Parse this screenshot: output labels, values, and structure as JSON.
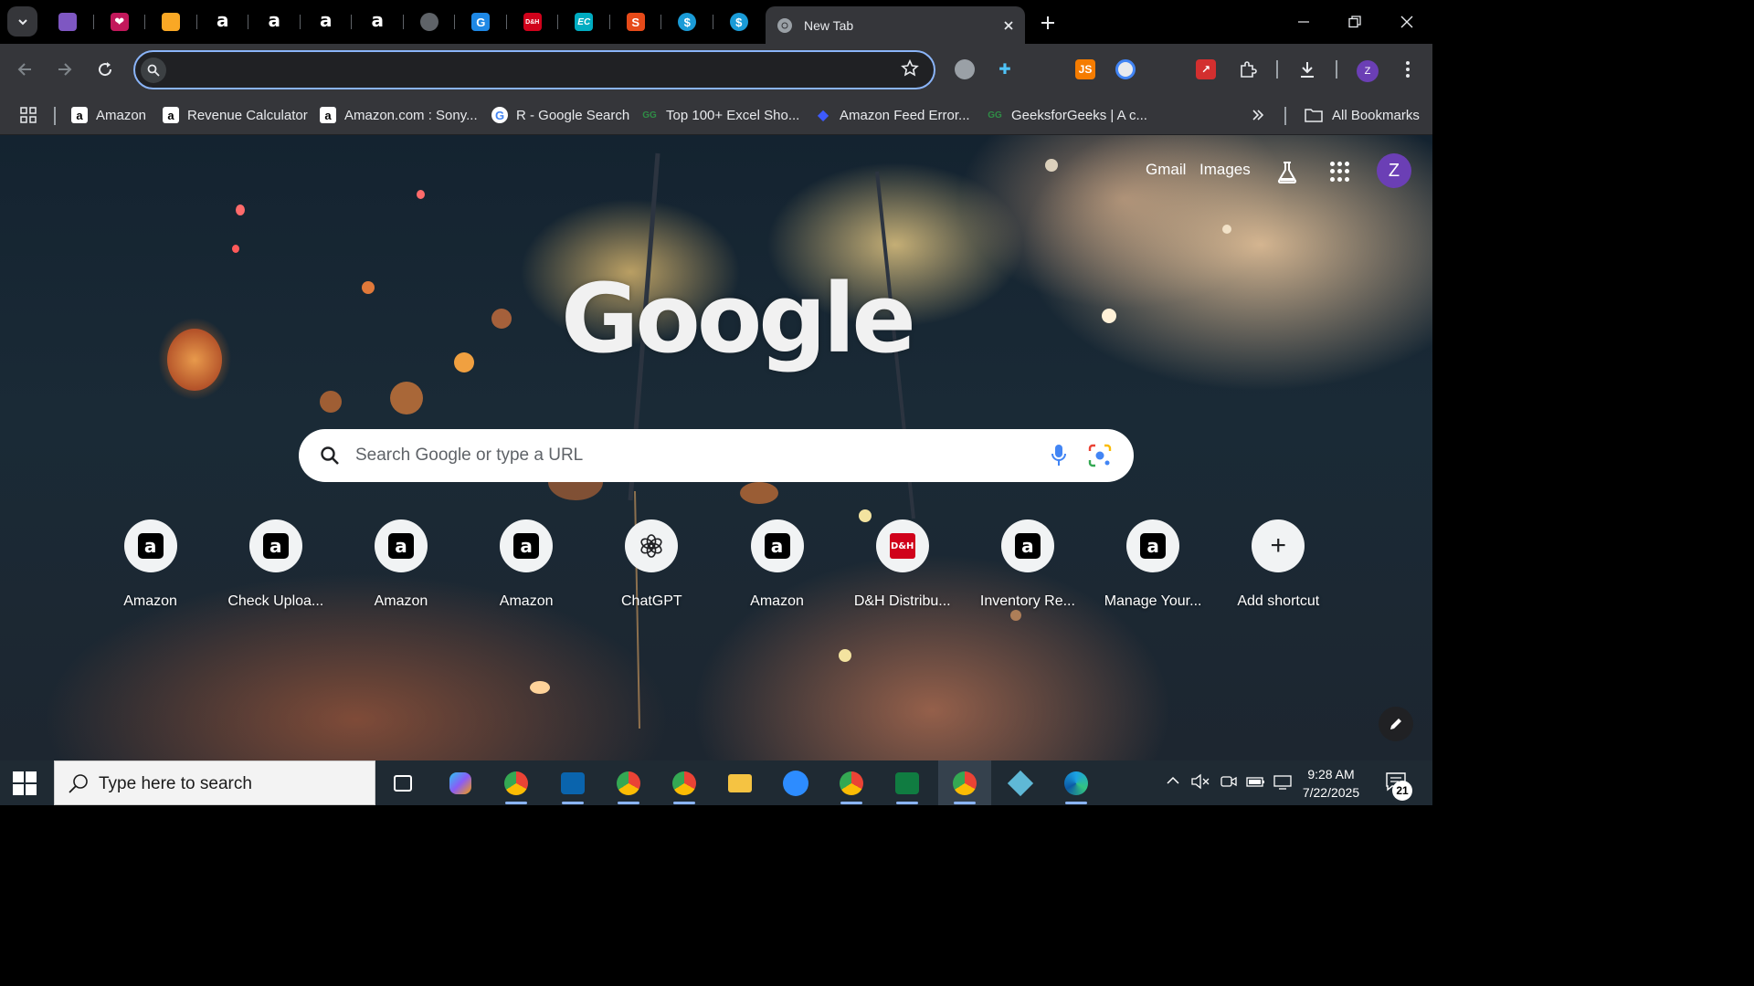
{
  "browser": {
    "active_tab_title": "New Tab",
    "pinned_tabs": [
      {
        "icon": "cube-icon",
        "color": "#7e57c2",
        "text": ""
      },
      {
        "icon": "heart-app-icon",
        "color": "#c2185b",
        "text": "❤"
      },
      {
        "icon": "box-icon",
        "color": "#f9a825",
        "text": ""
      },
      {
        "icon": "amazon-icon",
        "color": "",
        "text": "a"
      },
      {
        "icon": "amazon-icon",
        "color": "",
        "text": "a"
      },
      {
        "icon": "amazon-icon",
        "color": "",
        "text": "a"
      },
      {
        "icon": "amazon-icon",
        "color": "",
        "text": "a"
      },
      {
        "icon": "globe-icon",
        "color": "#5f6368",
        "text": ""
      },
      {
        "icon": "g-app-icon",
        "color": "#1e88e5",
        "text": "G"
      },
      {
        "icon": "dh-icon",
        "color": "#d0021b",
        "text": "D&H"
      },
      {
        "icon": "ec-icon",
        "color": "#00acc1",
        "text": "EC"
      },
      {
        "icon": "stack-icon",
        "color": "#e64a19",
        "text": "S"
      },
      {
        "icon": "dollar-icon",
        "color": "#1a9bd7",
        "text": "$"
      },
      {
        "icon": "dollar-icon",
        "color": "#1a9bd7",
        "text": "$"
      }
    ],
    "omnibox": {
      "value": "",
      "placeholder": ""
    },
    "extensions": [
      {
        "icon": "globe-extension-icon",
        "color": "#9aa0a6",
        "text": ""
      },
      {
        "icon": "puzzle-plus-icon",
        "color": "#4fc3f7",
        "text": "✚"
      },
      {
        "icon": "cloud-extension-icon",
        "color": "#9aa0a6",
        "text": ""
      },
      {
        "icon": "js-icon",
        "color": "#f57c00",
        "text": "JS"
      },
      {
        "icon": "circle-extension-icon",
        "color": "#e8eaed",
        "text": ""
      },
      {
        "icon": "chart-extension-icon",
        "color": "#9aa0a6",
        "text": ""
      },
      {
        "icon": "arrow-extension-icon",
        "color": "#d32f2f",
        "text": "↗"
      }
    ],
    "profile_initial": "Z"
  },
  "bookmarks": {
    "items": [
      {
        "label": "Amazon",
        "icon": "amazon-icon"
      },
      {
        "label": "Revenue Calculator",
        "icon": "amazon-icon"
      },
      {
        "label": "Amazon.com : Sony...",
        "icon": "amazon-icon"
      },
      {
        "label": "R - Google Search",
        "icon": "google-icon"
      },
      {
        "label": "Top 100+ Excel Sho...",
        "icon": "gfg-icon"
      },
      {
        "label": "Amazon Feed Error...",
        "icon": "diamond-icon"
      },
      {
        "label": "GeeksforGeeks | A c...",
        "icon": "gfg-icon"
      }
    ],
    "all_bookmarks_label": "All Bookmarks"
  },
  "ntp": {
    "links": {
      "gmail": "Gmail",
      "images": "Images"
    },
    "logo": "Google",
    "search_placeholder": "Search Google or type a URL",
    "profile_initial": "Z",
    "shortcuts": [
      {
        "label": "Amazon",
        "icon": "amazon-icon"
      },
      {
        "label": "Check Uploa...",
        "icon": "amazon-icon"
      },
      {
        "label": "Amazon",
        "icon": "amazon-icon"
      },
      {
        "label": "Amazon",
        "icon": "amazon-icon"
      },
      {
        "label": "ChatGPT",
        "icon": "chatgpt-icon"
      },
      {
        "label": "Amazon",
        "icon": "amazon-icon"
      },
      {
        "label": "D&H Distribu...",
        "icon": "dh-icon"
      },
      {
        "label": "Inventory Re...",
        "icon": "amazon-icon"
      },
      {
        "label": "Manage Your...",
        "icon": "amazon-icon"
      },
      {
        "label": "Add shortcut",
        "icon": "plus-icon"
      }
    ]
  },
  "taskbar": {
    "search_placeholder": "Type here to search",
    "time": "9:28 AM",
    "date": "7/22/2025",
    "notification_count": "21",
    "apps": [
      {
        "icon": "task-view-icon"
      },
      {
        "icon": "copilot-icon"
      },
      {
        "icon": "chrome-profile-icon"
      },
      {
        "icon": "outlook-icon"
      },
      {
        "icon": "chrome-profile-icon"
      },
      {
        "icon": "chrome-profile-icon"
      },
      {
        "icon": "file-explorer-icon"
      },
      {
        "icon": "zoom-icon"
      },
      {
        "icon": "chrome-icon"
      },
      {
        "icon": "excel-icon"
      },
      {
        "icon": "chrome-profile-z-icon"
      },
      {
        "icon": "diamond-app-icon"
      },
      {
        "icon": "edge-icon"
      }
    ]
  }
}
